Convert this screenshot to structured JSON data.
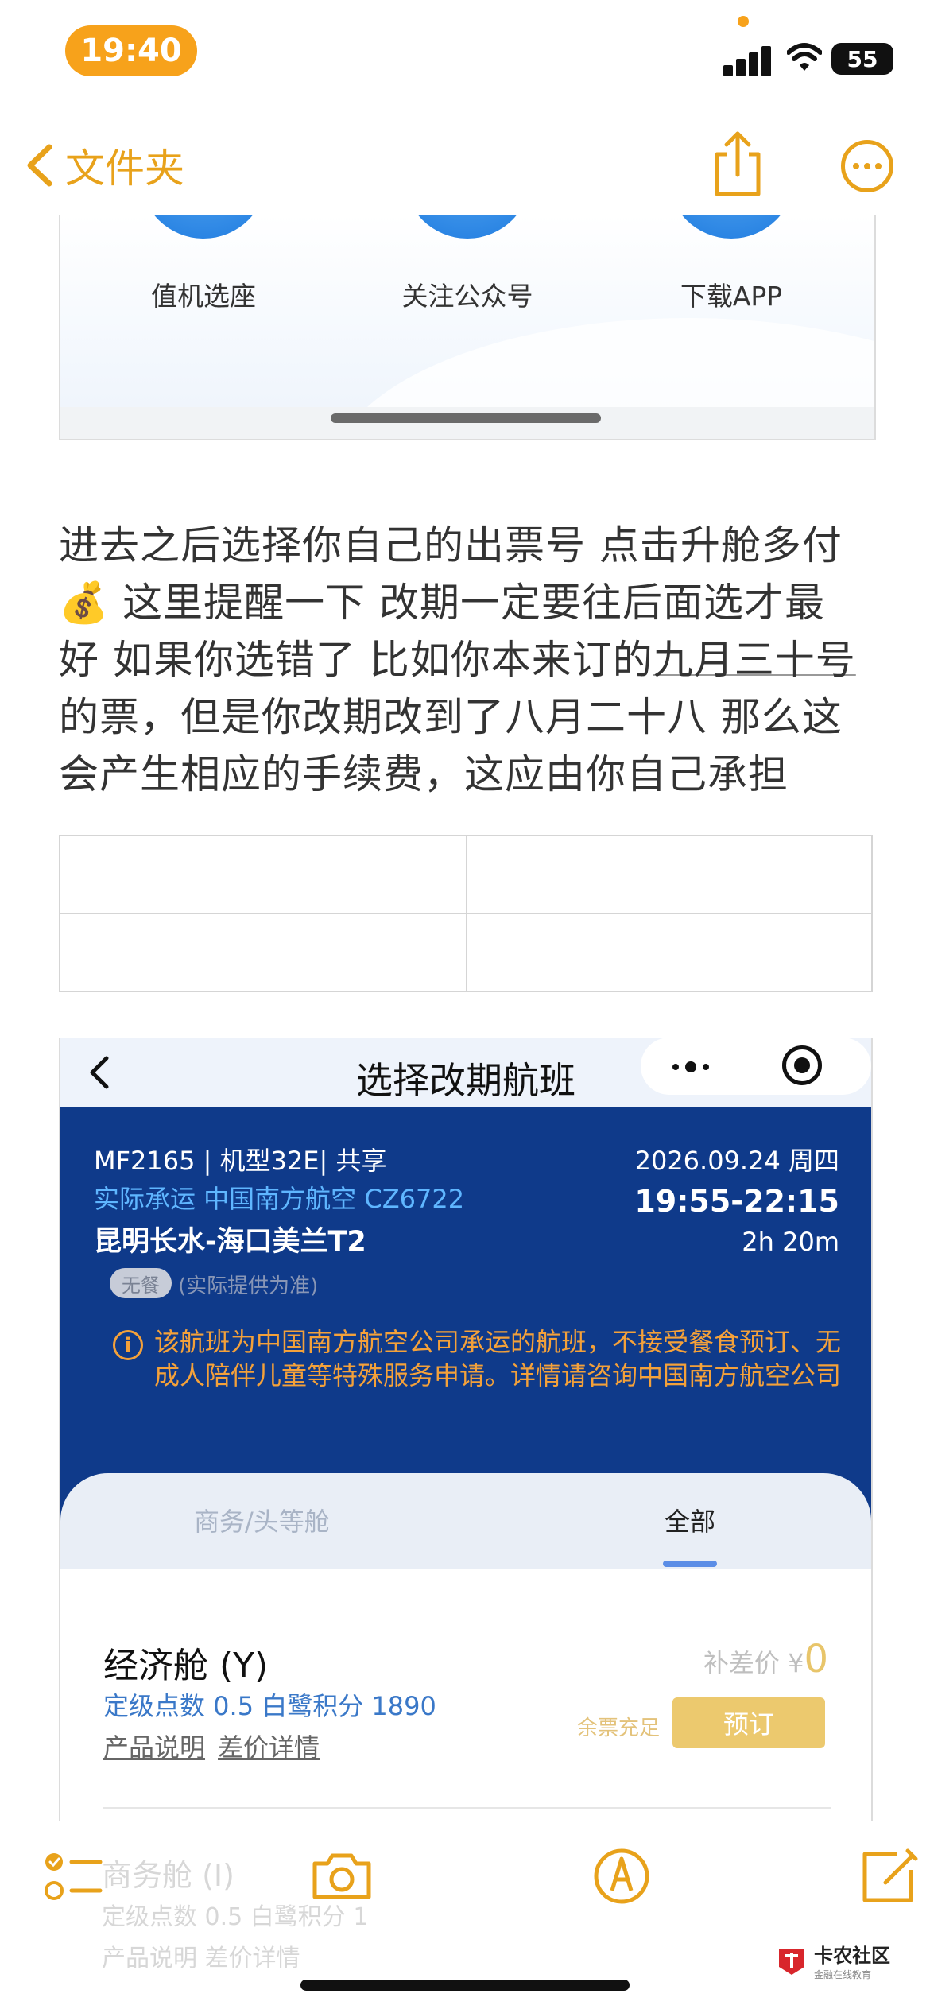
{
  "status": {
    "time": "19:40",
    "battery": "55"
  },
  "nav": {
    "back_label": "文件夹"
  },
  "card1": {
    "labels": [
      "值机选座",
      "关注公众号",
      "下载APP"
    ]
  },
  "note": {
    "line1": "进去之后选择你自己的出票号  点击升舱多付",
    "line2": "💰 这里提醒一下 改期一定要往后面选才最",
    "line3a": "好 如果你选错了 比如你本来订的",
    "line3b": "九月三十号",
    "line4": "的票，但是你改期改到了八月二十八 那么这",
    "line5": "会产生相应的手续费，这应由你自己承担"
  },
  "shot2": {
    "title": "选择改期航班",
    "flight": "MF2165 | 机型32E| 共享",
    "carrier": "实际承运  中国南方航空  CZ6722",
    "route": "昆明长水-海口美兰T2",
    "date": "2026.09.24 周四",
    "time": "19:55-22:15",
    "duration": "2h 20m",
    "meal_badge": "无餐",
    "meal_note": "(实际提供为准)",
    "warn_icon": "i",
    "warning": "该航班为中国南方航空公司承运的航班，不接受餐食预订、无成人陪伴儿童等特殊服务申请。详情请咨询中国南方航空公司",
    "tabs": [
      "商务/头等舱",
      "全部"
    ],
    "fare": {
      "cabin": "经济舱 (Y)",
      "points": "定级点数 0.5   白鹭积分 1890",
      "link1": "产品说明",
      "link2": "差价详情",
      "diff_label": "补差价 ¥",
      "diff_value": "0",
      "stock": "余票充足",
      "book": "预订"
    },
    "next_cabin": "商务舱 (I)",
    "next_points": "定级点数 0.5   白鹭积分 1",
    "next_links": "产品说明  差价详情"
  },
  "watermark": {
    "main": "卡农社区",
    "sub": "金融在线教育"
  },
  "colors": {
    "accent": "#e8a21b",
    "flight_blue": "#0f3a8a",
    "warning": "#f4a13a"
  }
}
